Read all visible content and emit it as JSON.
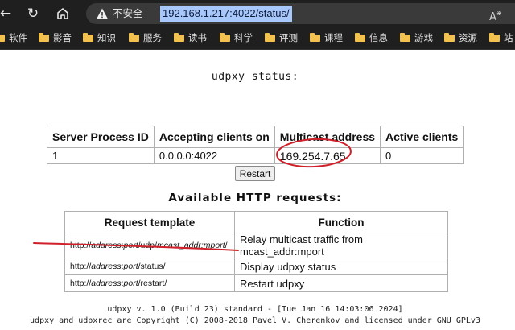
{
  "browser": {
    "security_label": "不安全",
    "url": "192.168.1.217:4022/status/",
    "read_aloud": "A",
    "bookmarks": [
      "软件",
      "影音",
      "知识",
      "服务",
      "读书",
      "科学",
      "评测",
      "课程",
      "信息",
      "游戏",
      "资源",
      "站"
    ]
  },
  "page": {
    "title": "udpxy status:",
    "status_table": {
      "headers": [
        "Server Process ID",
        "Accepting clients on",
        "Multicast address",
        "Active clients"
      ],
      "row": [
        "1",
        "0.0.0.0:4022",
        "169.254.7.65",
        "0"
      ]
    },
    "restart_label": "Restart",
    "requests_title": "Available HTTP requests:",
    "requests_table": {
      "headers": [
        "Request template",
        "Function"
      ],
      "rows": [
        {
          "prefix": "http://",
          "addr": "address",
          "colon": ":",
          "port": "port",
          "path": "/udp/",
          "arg": "mcast_addr",
          "colon2": ":",
          "arg2": "mport",
          "tail": "/",
          "function": "Relay multicast traffic from mcast_addr:mport"
        },
        {
          "prefix": "http://",
          "addr": "address",
          "colon": ":",
          "port": "port",
          "path": "/status/",
          "function": "Display udpxy status"
        },
        {
          "prefix": "http://",
          "addr": "address",
          "colon": ":",
          "port": "port",
          "path": "/restart/",
          "function": "Restart udpxy"
        }
      ]
    },
    "footer_line1": "udpxy v. 1.0 (Build 23) standard - [Tue Jan 16 14:03:06 2024]",
    "footer_line2": "udpxy and udpxrec are Copyright (C) 2008-2018 Pavel V. Cherenkov and licensed under GNU GPLv3"
  },
  "annotation_color": "#d0202a"
}
